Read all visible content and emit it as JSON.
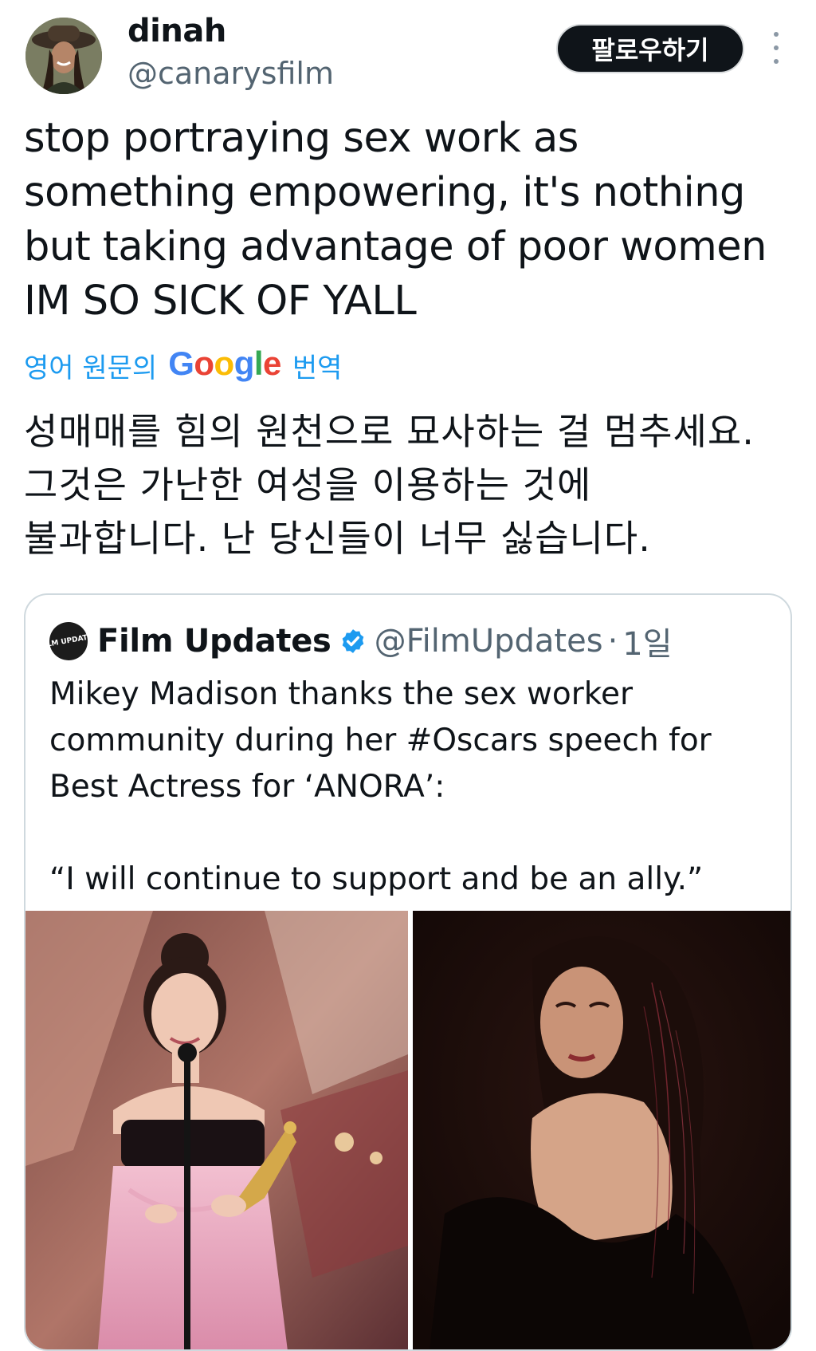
{
  "author": {
    "display_name": "dinah",
    "handle": "@canarysfilm",
    "avatar_icon": "profile-photo"
  },
  "follow_button_label": "팔로우하기",
  "more_icon": "more-vertical-icon",
  "tweet": {
    "text": "stop portraying sex work as something empowering, it's nothing but taking advantage of poor women IM SO SICK OF YALL"
  },
  "translation": {
    "label_prefix": "영어 원문의",
    "logo_letters": [
      "G",
      "o",
      "o",
      "g",
      "l",
      "e"
    ],
    "label_suffix": "번역",
    "lines": [
      "성매매를 힘의 원천으로 묘사하는 걸 멈추세요.",
      "그것은 가난한 여성을 이용하는 것에",
      "불과합니다. 난 당신들이 너무 싫습니다."
    ]
  },
  "quoted_tweet": {
    "avatar_text": "FILM UPDATES",
    "display_name": "Film Updates",
    "handle": "@FilmUpdates",
    "separator": "·",
    "time": "1일",
    "lines": [
      "Mikey Madison thanks the sex worker",
      "community during her #Oscars speech for",
      "Best Actress for ‘ANORA’:",
      "",
      "“I will continue to support and be an ally.”"
    ],
    "colors": {
      "verified": "#1d9bf0"
    }
  },
  "colors": {
    "text": "#0f1419",
    "secondary": "#536471",
    "link": "#1d9bf0",
    "follow_bg": "#0f1419"
  }
}
